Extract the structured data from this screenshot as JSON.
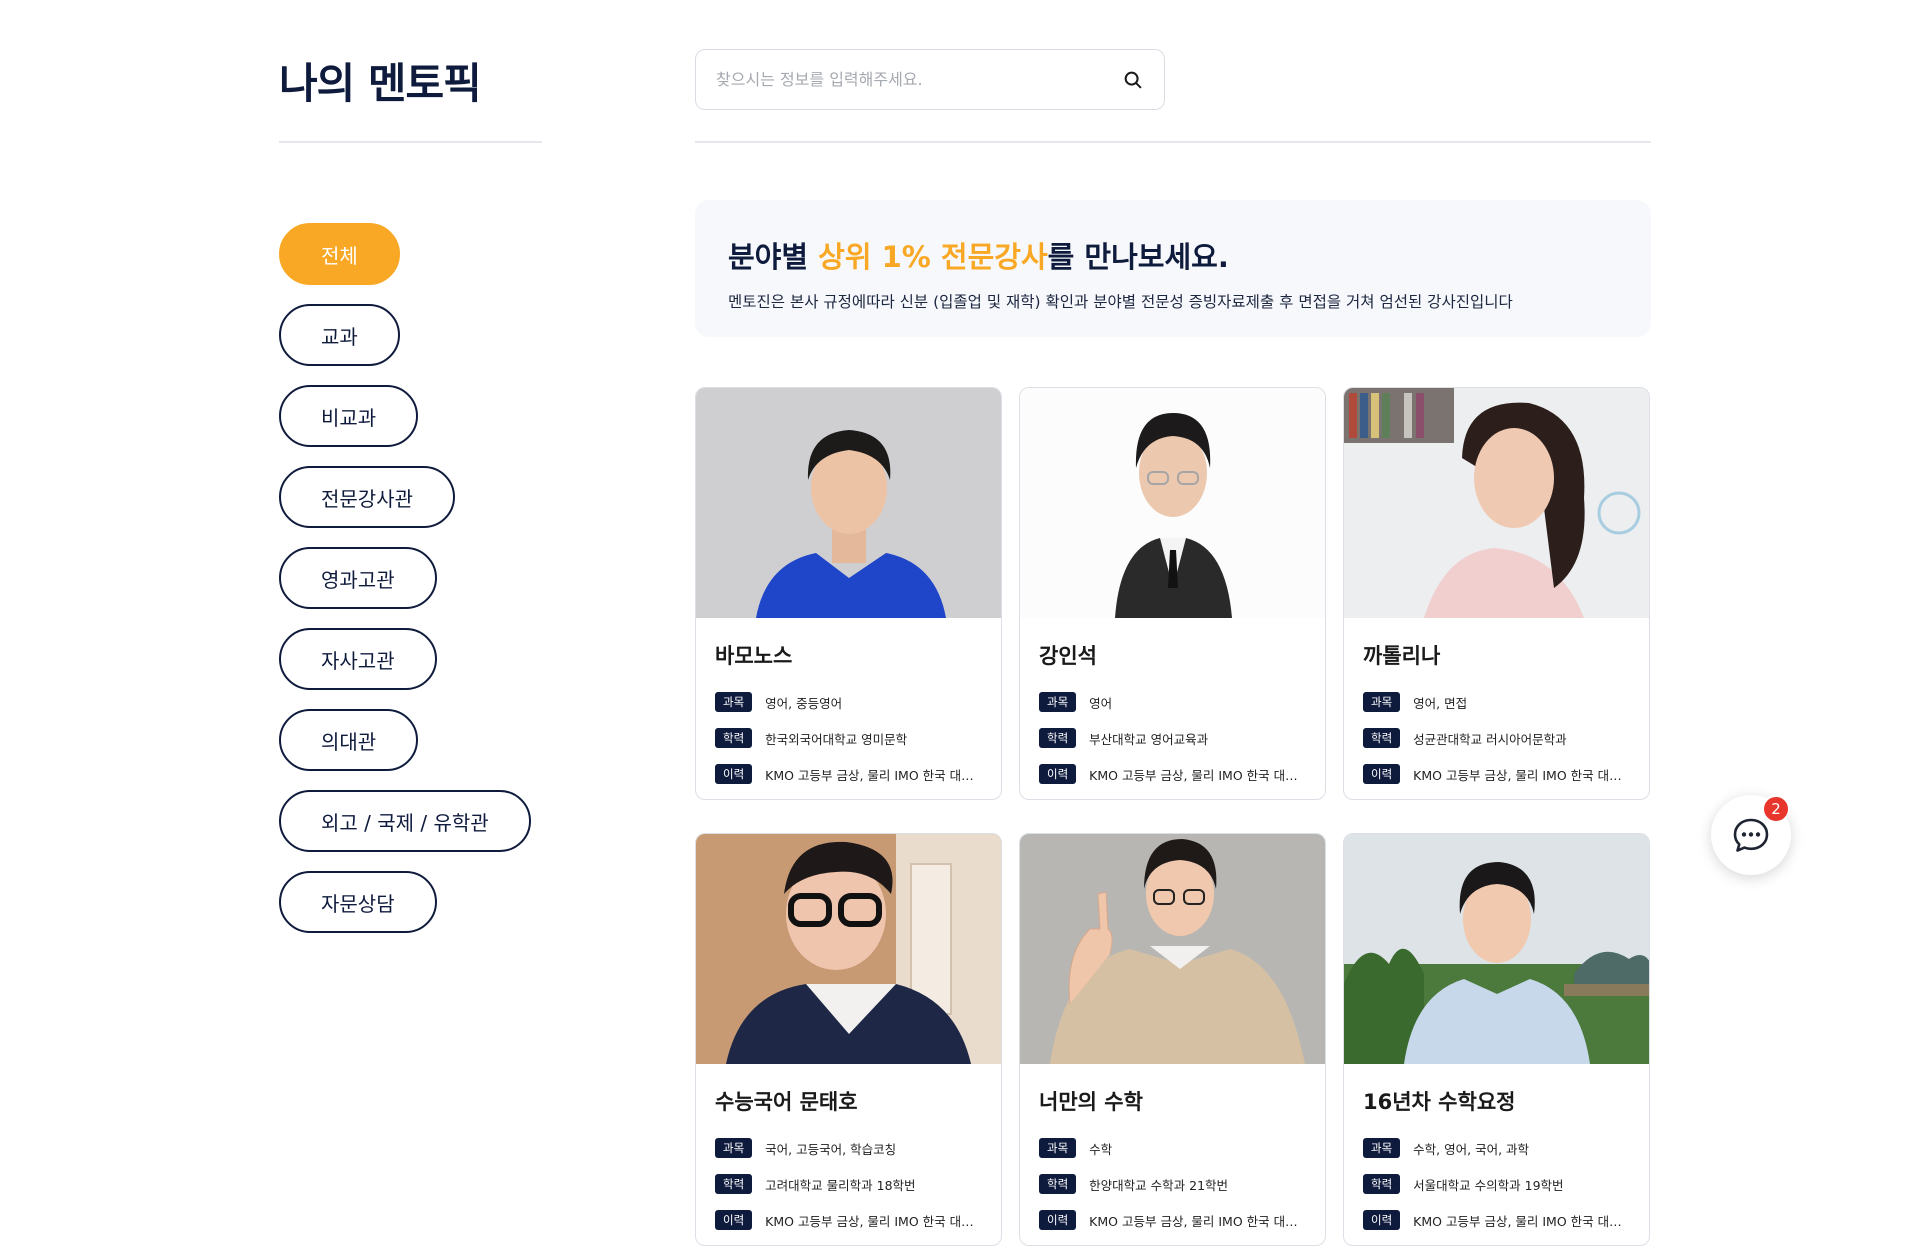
{
  "brand": {
    "title": "나의 멘토픽"
  },
  "search": {
    "placeholder": "찾으시는 정보를 입력해주세요."
  },
  "categories": [
    {
      "label": "전체",
      "active": true
    },
    {
      "label": "교과"
    },
    {
      "label": "비교과"
    },
    {
      "label": "전문강사관"
    },
    {
      "label": "영과고관"
    },
    {
      "label": "자사고관"
    },
    {
      "label": "의대관"
    },
    {
      "label": "외고 / 국제 / 유학관"
    },
    {
      "label": "자문상담"
    }
  ],
  "banner": {
    "title_pre": "분야별 ",
    "title_highlight": "상위 1% 전문강사",
    "title_post": "를 만나보세요.",
    "subtitle": "멘토진은 본사 규정에따라 신분 (입졸업 및 재학) 확인과 분야별 전문성 증빙자료제출 후 면접을 거쳐 엄선된 강사진입니다"
  },
  "labels": {
    "subject": "과목",
    "education": "학력",
    "career": "이력"
  },
  "mentors": [
    {
      "name": "바모노스",
      "subject": "영어, 중등영어",
      "education": "한국외국어대학교 영미문학",
      "career": "KMO 고등부 금상, 물리 IMO 한국 대표..."
    },
    {
      "name": "강인석",
      "subject": "영어",
      "education": "부산대학교 영어교육과",
      "career": "KMO 고등부 금상, 물리 IMO 한국 대표..."
    },
    {
      "name": "까톨리나",
      "subject": "영어, 면접",
      "education": "성균관대학교 러시아어문학과",
      "career": "KMO 고등부 금상, 물리 IMO 한국 대표..."
    },
    {
      "name": "수능국어 문태호",
      "subject": "국어, 고등국어, 학습코칭",
      "education": "고려대학교 물리학과 18학번",
      "career": "KMO 고등부 금상, 물리 IMO 한국 대표..."
    },
    {
      "name": "너만의 수학",
      "subject": "수학",
      "education": "한양대학교 수학과 21학번",
      "career": "KMO 고등부 금상, 물리 IMO 한국 대표..."
    },
    {
      "name": "16년차 수학요정",
      "subject": "수학, 영어, 국어, 과학",
      "education": "서울대학교 수의학과 19학번",
      "career": "KMO 고등부 금상, 물리 IMO 한국 대표..."
    }
  ],
  "chat": {
    "badge_count": "2"
  },
  "colors": {
    "accent": "#f9a825",
    "navy": "#0f1b3d",
    "badge": "#e8362d"
  }
}
